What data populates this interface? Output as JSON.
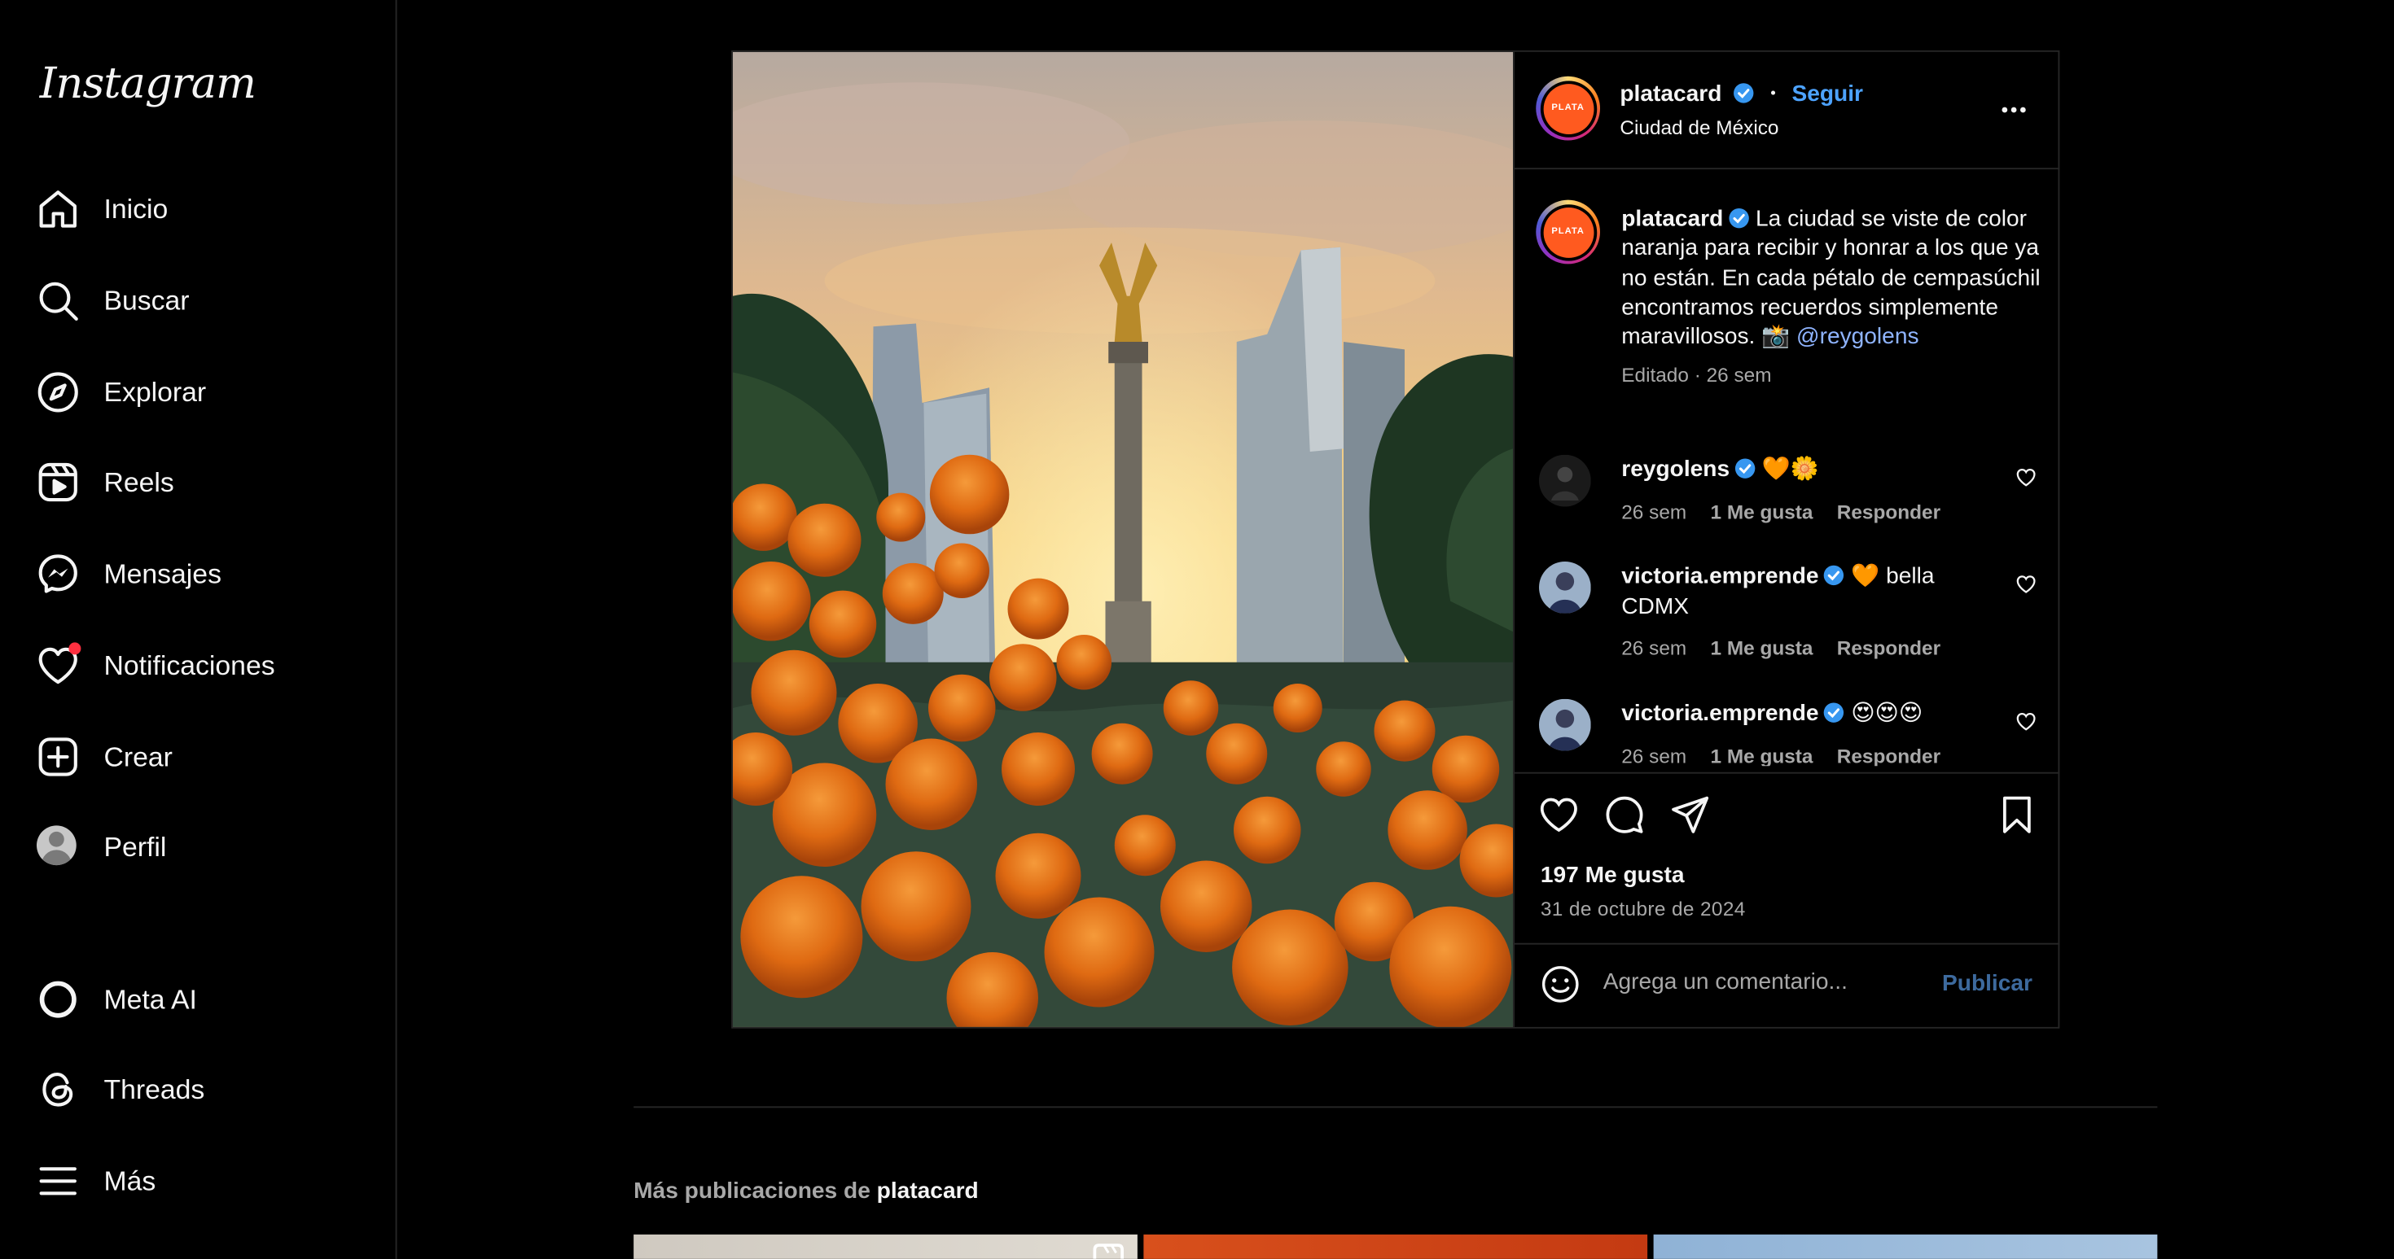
{
  "sidebar": {
    "logo": "Instagram",
    "items": [
      {
        "label": "Inicio",
        "icon": "home-icon"
      },
      {
        "label": "Buscar",
        "icon": "search-icon"
      },
      {
        "label": "Explorar",
        "icon": "compass-icon"
      },
      {
        "label": "Reels",
        "icon": "reels-icon"
      },
      {
        "label": "Mensajes",
        "icon": "messenger-icon"
      },
      {
        "label": "Notificaciones",
        "icon": "heart-icon"
      },
      {
        "label": "Crear",
        "icon": "plus-square-icon"
      },
      {
        "label": "Perfil",
        "icon": "avatar"
      },
      {
        "label": "Meta AI",
        "icon": "meta-ai-icon"
      },
      {
        "label": "Threads",
        "icon": "threads-icon"
      },
      {
        "label": "Más",
        "icon": "menu-icon"
      }
    ]
  },
  "post": {
    "author": "platacard",
    "avatar_text": "PLATA",
    "follow_label": "Seguir",
    "separator": "•",
    "location": "Ciudad de México",
    "caption_text": "La ciudad se viste de color naranja para recibir y honrar a los que ya no están. En cada pétalo de cempasúchil encontramos recuerdos simplemente maravillosos. 📸",
    "caption_mention": "@reygolens",
    "caption_meta": "Editado · 26 sem",
    "comments": [
      {
        "user": "reygolens",
        "text": "🧡🌼",
        "time": "26 sem",
        "likes": "1 Me gusta",
        "reply": "Responder"
      },
      {
        "user": "victoria.emprende",
        "text": "🧡 bella CDMX",
        "time": "26 sem",
        "likes": "1 Me gusta",
        "reply": "Responder"
      },
      {
        "user": "victoria.emprende",
        "text": "😍😍😍",
        "time": "26 sem",
        "likes": "1 Me gusta",
        "reply": "Responder"
      }
    ],
    "likes_count": "197 Me gusta",
    "date": "31 de octubre de 2024",
    "comment_placeholder": "Agrega un comentario...",
    "publish_label": "Publicar"
  },
  "more": {
    "prefix": "Más publicaciones de",
    "author": "platacard"
  },
  "colors": {
    "background": "#000000",
    "link_blue": "#4da3ff",
    "notification_red": "#ff3040",
    "border": "#262626"
  }
}
